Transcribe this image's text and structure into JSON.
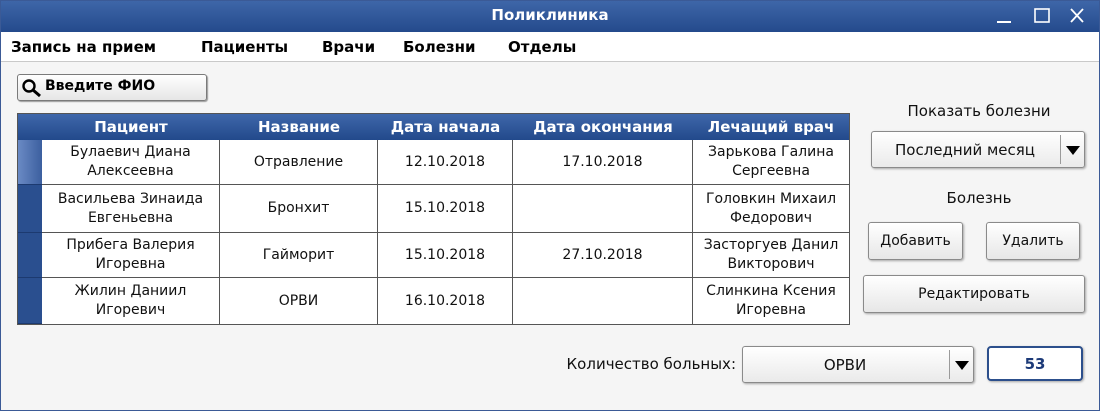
{
  "window": {
    "title": "Поликлиника"
  },
  "menu": [
    "Запись на прием",
    "Пациенты",
    "Врачи",
    "Болезни",
    "Отделы"
  ],
  "search": {
    "label": "Введите ФИО"
  },
  "table": {
    "columns": [
      "Пациент",
      "Название",
      "Дата начала",
      "Дата окончания",
      "Лечащий врач"
    ],
    "rows": [
      {
        "patient1": "Булаевич Диана",
        "patient2": "Алексеевна",
        "disease": "Отравление",
        "start": "12.10.2018",
        "end": "17.10.2018",
        "doctor1": "Зарькова Галина",
        "doctor2": "Сергеевна"
      },
      {
        "patient1": "Васильева Зинаида",
        "patient2": "Евгеньевна",
        "disease": "Бронхит",
        "start": "15.10.2018",
        "end": "",
        "doctor1": "Головкин Михаил",
        "doctor2": "Федорович"
      },
      {
        "patient1": "Прибега Валерия",
        "patient2": "Игоревна",
        "disease": "Гайморит",
        "start": "15.10.2018",
        "end": "27.10.2018",
        "doctor1": "Засторгуев Данил",
        "doctor2": "Викторович"
      },
      {
        "patient1": "Жилин Даниил",
        "patient2": "Игоревич",
        "disease": "ОРВИ",
        "start": "16.10.2018",
        "end": "",
        "doctor1": "Слинкина Ксения",
        "doctor2": "Игоревна"
      }
    ]
  },
  "panel": {
    "show_label": "Показать болезни",
    "period_value": "Последний месяц",
    "disease_label": "Болезнь",
    "add_button": "Добавить",
    "delete_button": "Удалить",
    "edit_button": "Редактировать"
  },
  "footer": {
    "count_label": "Количество больных:",
    "disease_value": "ОРВИ",
    "count_value": "53"
  },
  "colors": {
    "titlebar": "#2f5597",
    "header": "#2f5597",
    "count_text": "#1c3a78"
  }
}
